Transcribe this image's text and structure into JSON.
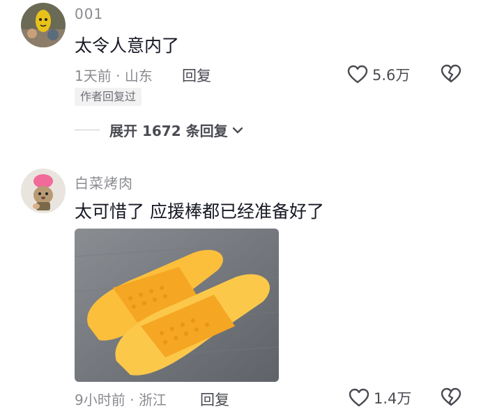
{
  "comments": [
    {
      "username": "001",
      "text": "太令人意内了",
      "time": "1天前",
      "separator": "·",
      "location": "山东",
      "reply_label": "回复",
      "like_count": "5.6万",
      "badge": "作者回复过",
      "expand_label": "展开 1672 条回复",
      "avatar_icon": "lemon-avatar-icon"
    },
    {
      "username": "白菜烤肉",
      "text": "太可惜了 应援棒都已经准备好了",
      "time": "9小时前",
      "separator": "·",
      "location": "浙江",
      "reply_label": "回复",
      "like_count": "1.4万",
      "image_desc": "yellow-slippers",
      "avatar_icon": "pink-cat-avatar-icon"
    }
  ],
  "icons": {
    "like": "heart-outline-icon",
    "dislike": "broken-heart-icon",
    "expand": "chevron-down-icon"
  },
  "colors": {
    "text_primary": "#161823",
    "text_secondary": "#8a8b91",
    "slipper": "#fbbf3c"
  }
}
